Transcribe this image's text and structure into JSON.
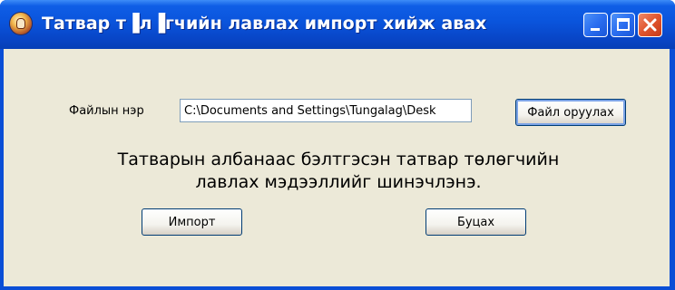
{
  "window": {
    "title": "Татвар т▐л▐гчийн лавлах импорт хийж авах",
    "app_icon": "app-icon",
    "controls": [
      "minimize-icon",
      "maximize-icon",
      "close-icon"
    ],
    "colors": {
      "titlebar": "#0a54dc",
      "client": "#ece9d8",
      "close": "#e0552e"
    }
  },
  "form": {
    "file_label": "Файлын нэр",
    "file_path_value": "C:\\Documents and Settings\\Tungalag\\Desk",
    "browse_button_label": "Файл оруулах",
    "message_line1": "Татварын албанаас бэлтгэсэн татвар төлөгчийн",
    "message_line2": "лавлах мэдээллийг шинэчлэнэ.",
    "import_button_label": "Импорт",
    "back_button_label": "Буцах"
  }
}
